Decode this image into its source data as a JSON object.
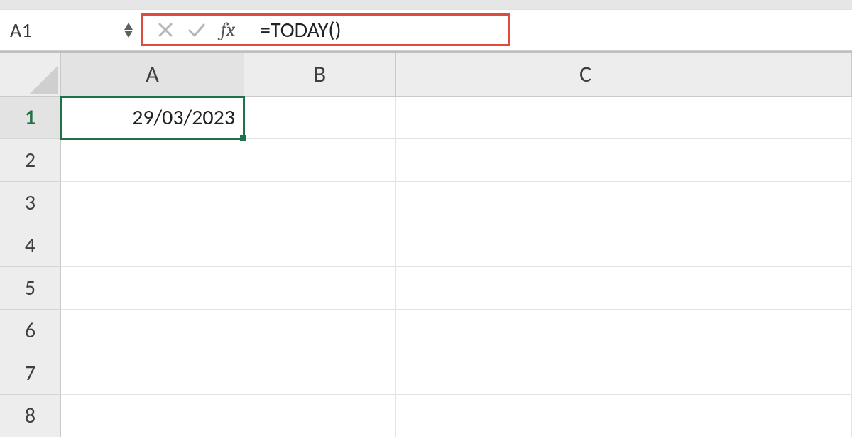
{
  "formula_bar": {
    "name_box": "A1",
    "fx_label": "fx",
    "formula": "=TODAY()"
  },
  "columns": {
    "A": "A",
    "B": "B",
    "C": "C"
  },
  "rows": [
    "1",
    "2",
    "3",
    "4",
    "5",
    "6",
    "7",
    "8"
  ],
  "cells": {
    "A1": "29/03/2023"
  },
  "selection": "A1"
}
